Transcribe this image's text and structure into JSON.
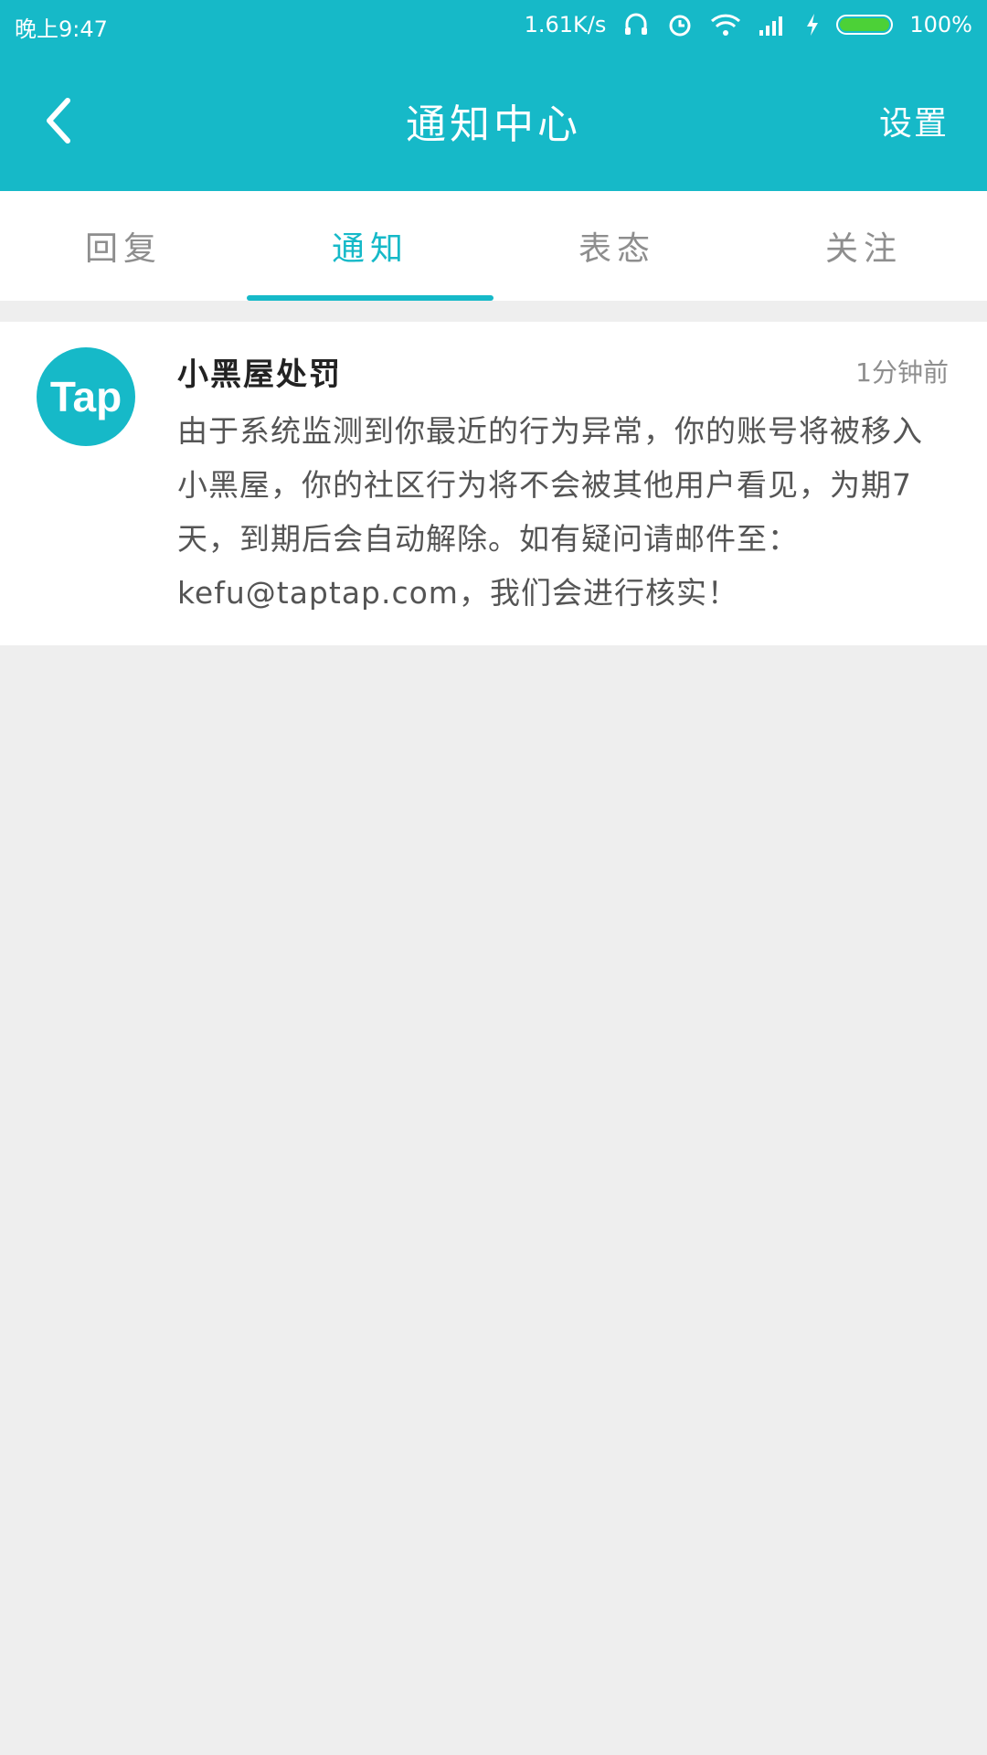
{
  "status_bar": {
    "time": "晚上9:47",
    "speed": "1.61K/s",
    "battery_level": 1.0,
    "battery_text": "100%"
  },
  "app_bar": {
    "title": "通知中心",
    "settings_label": "设置"
  },
  "tabs": [
    {
      "label": "回复",
      "active": false
    },
    {
      "label": "通知",
      "active": true
    },
    {
      "label": "表态",
      "active": false
    },
    {
      "label": "关注",
      "active": false
    }
  ],
  "notice": {
    "avatar_text": "Tap",
    "sender": "小黑屋处罚",
    "time": "1分钟前",
    "message": "由于系统监测到你最近的行为异常，你的账号将被移入小黑屋，你的社区行为将不会被其他用户看见，为期7天，到期后会自动解除。如有疑问请邮件至：kefu@taptap.com，我们会进行核实！"
  },
  "colors": {
    "accent": "#16b9c8",
    "background": "#eeeeee",
    "battery_fill": "#4cd137"
  },
  "icons": [
    "back-arrow-icon",
    "headphones-icon",
    "alarm-icon",
    "wifi-icon",
    "signal-icon",
    "charging-icon",
    "battery-icon"
  ]
}
